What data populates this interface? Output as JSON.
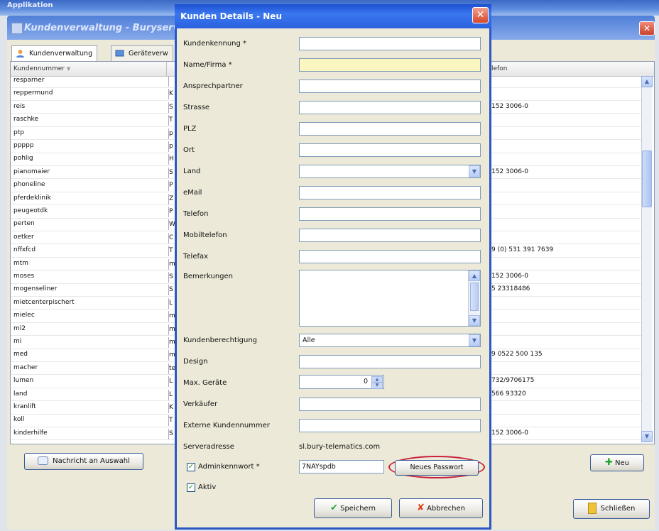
{
  "bg_app": {
    "top_label": "Applikation",
    "window_title": "Kundenverwaltung - Buryserv",
    "close": "✕",
    "tabs": [
      "Kundenverwaltung",
      "Geräteverw"
    ],
    "column_header": "Kundennummer",
    "right_header": "lefon",
    "rows": [
      {
        "k": "resparner",
        "c": "",
        "t": ""
      },
      {
        "k": "reppermund",
        "c": "K",
        "t": ""
      },
      {
        "k": "reis",
        "c": "S",
        "t": "152 3006-0"
      },
      {
        "k": "raschke",
        "c": "T",
        "t": ""
      },
      {
        "k": "ptp",
        "c": "p",
        "t": ""
      },
      {
        "k": "ppppp",
        "c": "p",
        "t": ""
      },
      {
        "k": "pohlig",
        "c": "H",
        "t": ""
      },
      {
        "k": "pianomaier",
        "c": "S",
        "t": "152 3006-0"
      },
      {
        "k": "phoneline",
        "c": "P",
        "t": ""
      },
      {
        "k": "pferdeklinik",
        "c": "Z",
        "t": ""
      },
      {
        "k": "peugeotdk",
        "c": "P",
        "t": ""
      },
      {
        "k": "perten",
        "c": "W",
        "t": ""
      },
      {
        "k": "oetker",
        "c": "C",
        "t": ""
      },
      {
        "k": "nffxfcd",
        "c": "T",
        "t": "9 (0) 531 391 7639"
      },
      {
        "k": "mtm",
        "c": "m",
        "t": ""
      },
      {
        "k": "moses",
        "c": "S",
        "t": "152 3006-0"
      },
      {
        "k": "mogenseliner",
        "c": "S",
        "t": "5 23318486"
      },
      {
        "k": "mietcenterpischert",
        "c": "L",
        "t": ""
      },
      {
        "k": "mielec",
        "c": "m",
        "t": ""
      },
      {
        "k": "mi2",
        "c": "m",
        "t": ""
      },
      {
        "k": "mi",
        "c": "m",
        "t": ""
      },
      {
        "k": "med",
        "c": "m",
        "t": "9 0522 500 135"
      },
      {
        "k": "macher",
        "c": "te",
        "t": ""
      },
      {
        "k": "lumen",
        "c": "L",
        "t": "732/9706175"
      },
      {
        "k": "land",
        "c": "L",
        "t": "566 93320"
      },
      {
        "k": "kranlift",
        "c": "K",
        "t": ""
      },
      {
        "k": "koll",
        "c": "T",
        "t": ""
      },
      {
        "k": "kinderhilfe",
        "c": "S",
        "t": "152 3006-0"
      }
    ],
    "btn_message": "Nachricht an Auswahl",
    "btn_new": "Neu",
    "btn_close": "Schließen"
  },
  "dialog": {
    "title": "Kunden Details - Neu",
    "close": "✕",
    "fields": {
      "kundenkennung": "Kundenkennung *",
      "name": "Name/Firma *",
      "ansprechpartner": "Ansprechpartner",
      "strasse": "Strasse",
      "plz": "PLZ",
      "ort": "Ort",
      "land": "Land",
      "email": "eMail",
      "telefon": "Telefon",
      "mobil": "Mobiltelefon",
      "telefax": "Telefax",
      "bemerkungen": "Bemerkungen",
      "berechtigung": "Kundenberechtigung",
      "design": "Design",
      "max_geraete": "Max. Geräte",
      "verkaeufer": "Verkäufer",
      "externe": "Externe Kundennummer",
      "serveradresse": "Serveradresse",
      "adminkennwort": "Adminkennwort *",
      "aktiv": "Aktiv"
    },
    "values": {
      "berechtigung": "Alle",
      "max_geraete": "0",
      "serveradresse": "sl.bury-telematics.com",
      "adminkennwort": "7NAYspdb"
    },
    "btn_neues_passwort": "Neues Passwort",
    "btn_speichern": "Speichern",
    "btn_abbrechen": "Abbrechen",
    "highlight_color": "#c8203a",
    "required_field_color": "#fbf6bf"
  }
}
